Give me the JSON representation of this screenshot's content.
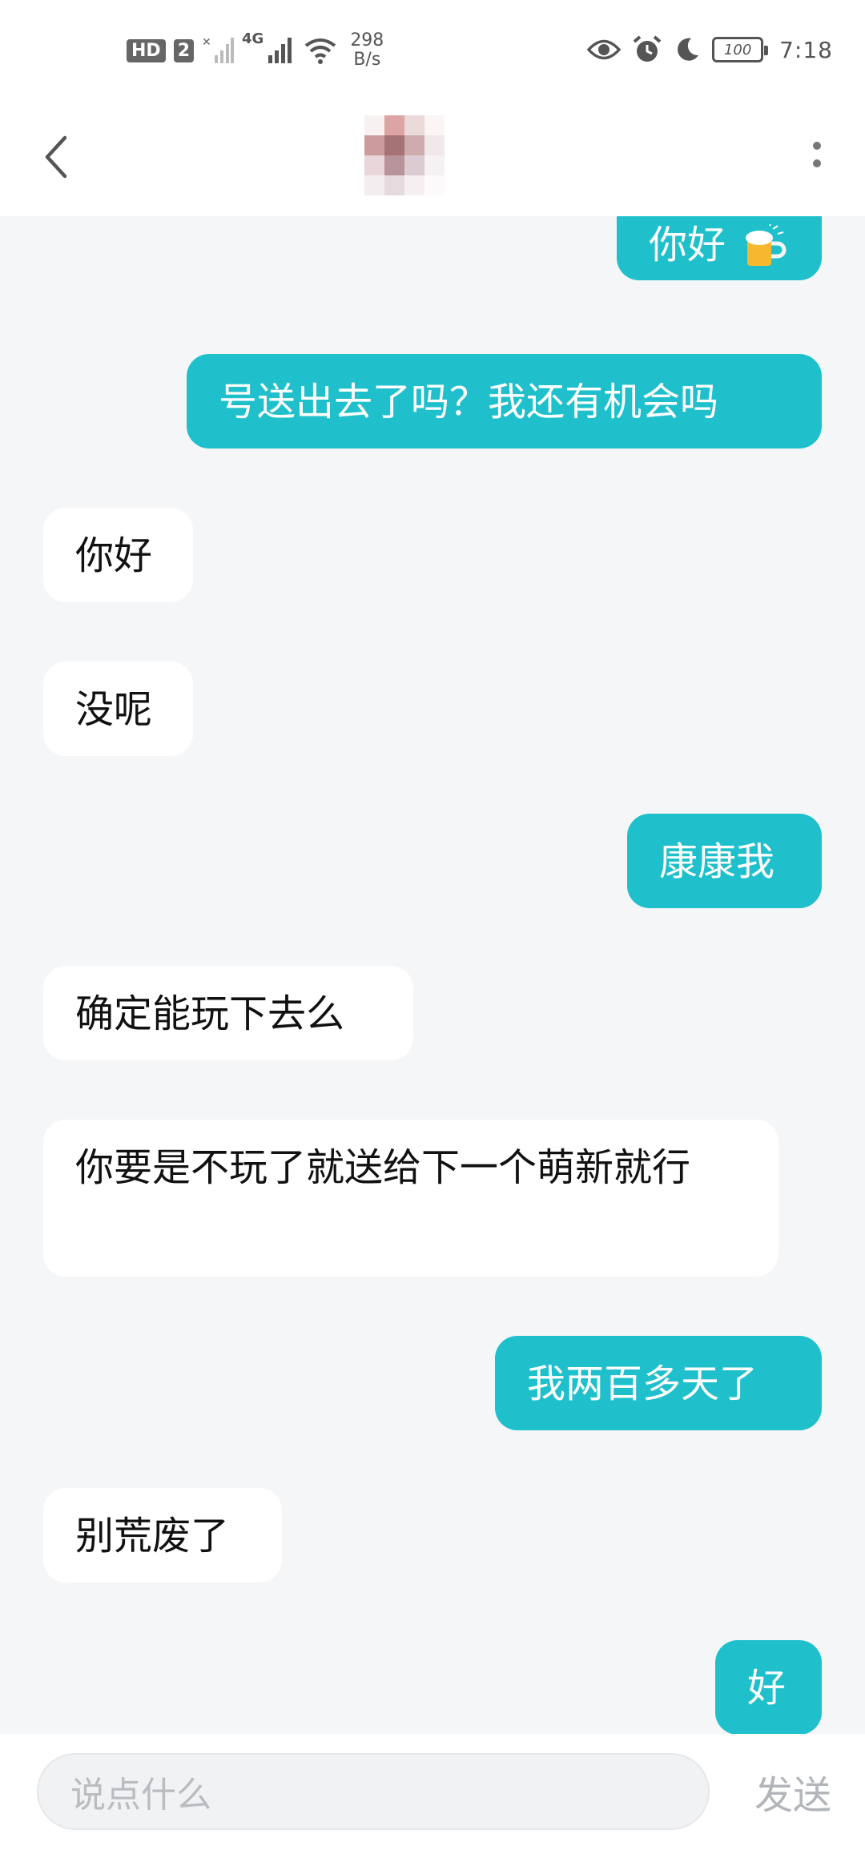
{
  "status_bar": {
    "hd_label": "HD",
    "sim_label": "2",
    "network_type": "4G",
    "net_speed_value": "298",
    "net_speed_unit": "B/s",
    "battery_level": "100",
    "time": "7:18"
  },
  "icons": {
    "back": "chevron-left-icon",
    "more": "more-vertical-icon",
    "eye": "eye-icon",
    "alarm": "alarm-icon",
    "moon": "moon-icon",
    "wifi": "wifi-icon",
    "beer": "beer-mug-icon"
  },
  "colors": {
    "outgoing_bubble": "#1fc0cb",
    "incoming_bubble": "#ffffff",
    "background": "#f5f6f8"
  },
  "messages": [
    {
      "side": "out",
      "text": "你好"
    },
    {
      "side": "out",
      "text": "号送出去了吗？我还有机会吗"
    },
    {
      "side": "in",
      "text": "你好"
    },
    {
      "side": "in",
      "text": "没呢"
    },
    {
      "side": "out",
      "text": "康康我"
    },
    {
      "side": "in",
      "text": "确定能玩下去么"
    },
    {
      "side": "in",
      "text": "你要是不玩了就送给下一个萌新就行"
    },
    {
      "side": "out",
      "text": "我两百多天了"
    },
    {
      "side": "in",
      "text": "别荒废了"
    },
    {
      "side": "out",
      "text": "好"
    }
  ],
  "composer": {
    "placeholder": "说点什么",
    "send_label": "发送"
  }
}
